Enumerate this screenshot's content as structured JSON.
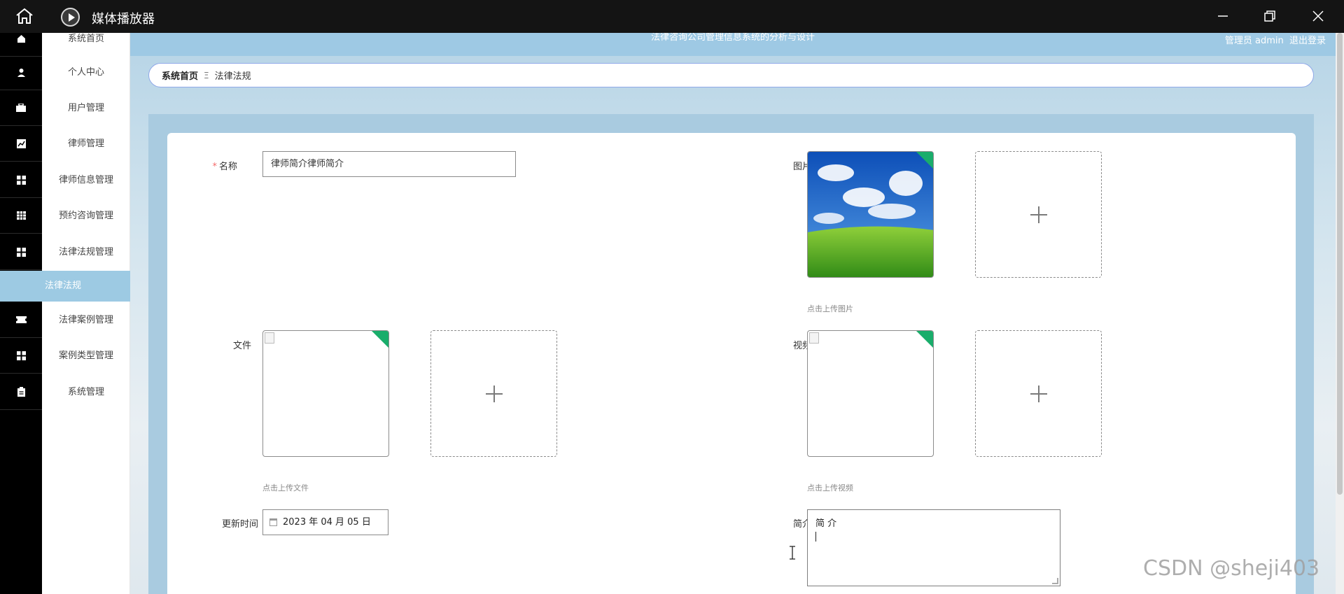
{
  "player": {
    "title": "媒体播放器"
  },
  "system": {
    "title": "法律咨询公司管理信息系统的分析与设计",
    "user": "管理员 admin",
    "logout": "退出登录"
  },
  "sidebar": {
    "items": [
      {
        "label": "系统首页",
        "icon": "home-icon"
      },
      {
        "label": "个人中心",
        "icon": "user-icon"
      },
      {
        "label": "用户管理",
        "icon": "briefcase-icon"
      },
      {
        "label": "律师管理",
        "icon": "chart-icon"
      },
      {
        "label": "律师信息管理",
        "icon": "grid-icon"
      },
      {
        "label": "预约咨询管理",
        "icon": "table-icon"
      },
      {
        "label": "法律法规管理",
        "icon": "grid-icon"
      },
      {
        "label": "法律案例管理",
        "icon": "ticket-icon"
      },
      {
        "label": "案例类型管理",
        "icon": "grid-icon"
      },
      {
        "label": "系统管理",
        "icon": "clipboard-icon"
      }
    ],
    "active_sub": "法律法规"
  },
  "breadcrumb": {
    "home": "系统首页",
    "separator": "Ξ",
    "current": "法律法规"
  },
  "form": {
    "name_label": "名称",
    "name_value": "律师简介律师简介",
    "image_label": "图片",
    "image_tip": "点击上传图片",
    "file_label": "文件",
    "file_tip": "点击上传文件",
    "video_label": "视频",
    "video_tip": "点击上传视频",
    "updated_label": "更新时间",
    "updated_value": "2023 年 04 月 05 日",
    "intro_label": "简介",
    "intro_value": "简 介"
  },
  "watermark": "CSDN @sheji403",
  "colors": {
    "accent": "#9dcae3",
    "upload_badge": "#1aad6b",
    "required": "#f56c6c"
  }
}
